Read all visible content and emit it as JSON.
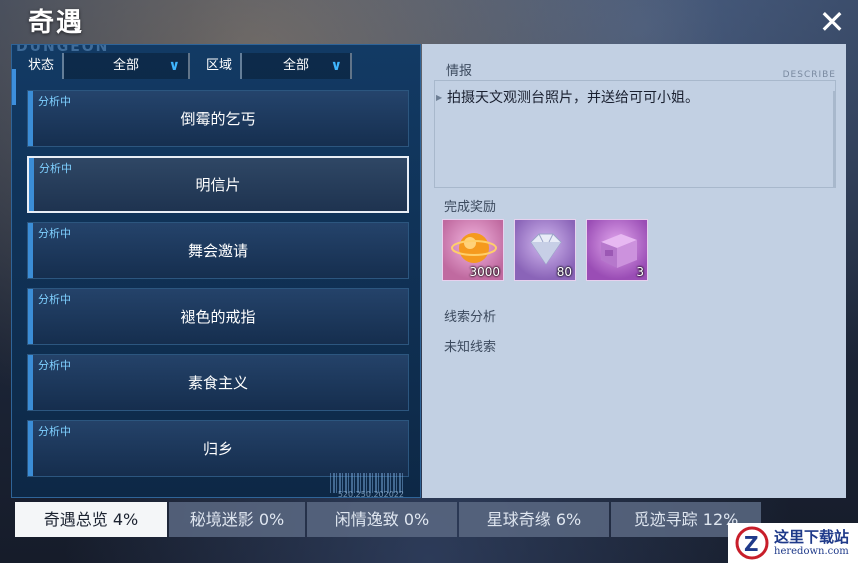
{
  "header": {
    "title": "奇遇"
  },
  "left_panel": {
    "watermark": "DUNGEON",
    "filters": [
      {
        "label": "状态",
        "value": "全部"
      },
      {
        "label": "区域",
        "value": "全部"
      }
    ],
    "items": [
      {
        "status": "分析中",
        "name": "倒霉的乞丐"
      },
      {
        "status": "分析中",
        "name": "明信片"
      },
      {
        "status": "分析中",
        "name": "舞会邀请"
      },
      {
        "status": "分析中",
        "name": "褪色的戒指"
      },
      {
        "status": "分析中",
        "name": "素食主义"
      },
      {
        "status": "分析中",
        "name": "归乡"
      }
    ],
    "barcode_text": "520.250.202022"
  },
  "right_panel": {
    "info_label": "情报",
    "describe_tag": "DESCRIBE",
    "info_text": "拍摄天文观测台照片，并送给可可小姐。",
    "reward_label": "完成奖励",
    "rewards": [
      {
        "icon": "orange-orb-icon",
        "amount": "3000"
      },
      {
        "icon": "diamond-icon",
        "amount": "80"
      },
      {
        "icon": "purple-chest-icon",
        "amount": "3"
      }
    ],
    "clue_label": "线索分析",
    "clue_value": "未知线索"
  },
  "tabs": [
    {
      "label": "奇遇总览 4%",
      "active": true
    },
    {
      "label": "秘境迷影 0%"
    },
    {
      "label": "闲情逸致 0%"
    },
    {
      "label": "星球奇缘 6%"
    },
    {
      "label": "觅迹寻踪 12%"
    }
  ],
  "watermark_logo": {
    "main": "这里下载站",
    "sub": "heredown.com"
  },
  "colors": {
    "accent": "#3b8dd6",
    "panel_left": "#123a64",
    "panel_right": "#c2d0e3"
  }
}
